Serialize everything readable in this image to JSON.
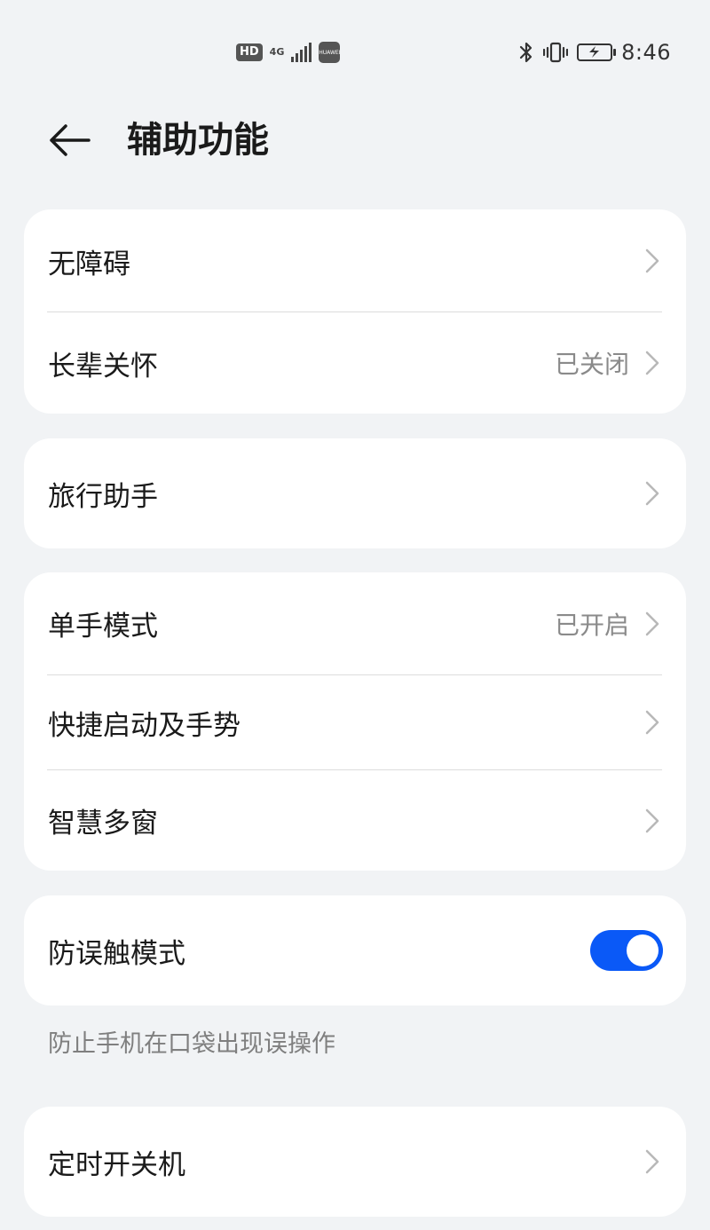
{
  "status_bar": {
    "hd_label": "HD",
    "network_label": "4G",
    "huawei_label": "HUAWEI",
    "time": "8:46",
    "icons": [
      "hd-icon",
      "signal-icon",
      "huawei-app-icon",
      "bluetooth-icon",
      "vibrate-icon",
      "battery-charging-icon"
    ]
  },
  "header": {
    "title": "辅助功能",
    "back_icon": "arrow-left-icon"
  },
  "groups": [
    {
      "items": [
        {
          "label": "无障碍",
          "value": ""
        },
        {
          "label": "长辈关怀",
          "value": "已关闭"
        }
      ]
    },
    {
      "items": [
        {
          "label": "旅行助手",
          "value": ""
        }
      ]
    },
    {
      "items": [
        {
          "label": "单手模式",
          "value": "已开启"
        },
        {
          "label": "快捷启动及手势",
          "value": ""
        },
        {
          "label": "智慧多窗",
          "value": ""
        }
      ]
    },
    {
      "items": [
        {
          "label": "防误触模式",
          "toggle_on": true
        }
      ],
      "hint": "防止手机在口袋出现误操作"
    },
    {
      "items": [
        {
          "label": "定时开关机",
          "value": ""
        }
      ]
    }
  ],
  "colors": {
    "background": "#f1f3f5",
    "card": "#ffffff",
    "toggle_on": "#0a59f7",
    "secondary_text": "#8a8a8a"
  }
}
